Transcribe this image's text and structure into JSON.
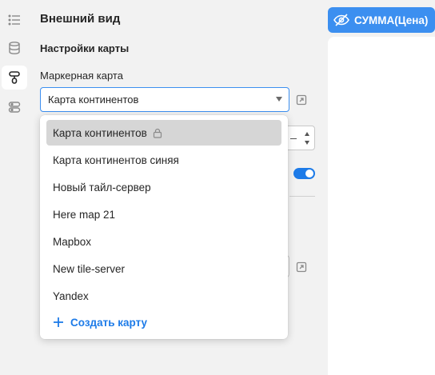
{
  "sidebar": {
    "items": [
      {
        "icon": "list-icon"
      },
      {
        "icon": "database-icon"
      },
      {
        "icon": "map-style-icon",
        "active": true
      },
      {
        "icon": "layers-icon"
      }
    ]
  },
  "panel": {
    "title": "Внешний вид",
    "section_title": "Настройки карты",
    "field_label": "Маркерная карта",
    "select_value": "Карта континентов"
  },
  "dropdown": {
    "options": [
      {
        "label": "Карта континентов",
        "selected": true,
        "locked": true
      },
      {
        "label": "Карта континентов синяя"
      },
      {
        "label": "Новый тайл-сервер"
      },
      {
        "label": "Here map 21"
      },
      {
        "label": "Mapbox"
      },
      {
        "label": "New tile-server"
      },
      {
        "label": "Yandex"
      }
    ],
    "create_label": "Создать карту"
  },
  "preview": {
    "field_pill": "СУММА(Цена)"
  },
  "colors": {
    "accent": "#3c8ff0",
    "link": "#1d7be8",
    "background": "#f2f2f2",
    "selected_option": "#d6d6d6"
  }
}
